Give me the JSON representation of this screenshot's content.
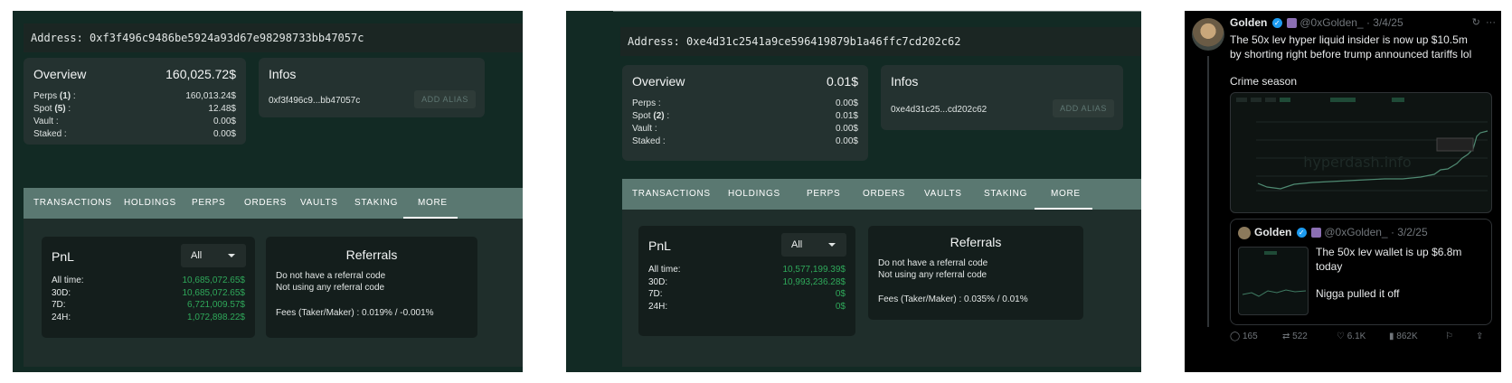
{
  "panel1": {
    "address": "Address: 0xf3f496c9486be5924a93d67e98298733bb47057c",
    "overview": {
      "title": "Overview",
      "total": "160,025.72$",
      "rows": [
        {
          "label": "Perps ",
          "count": "(1)",
          "suffix": " :",
          "value": "160,013.24$"
        },
        {
          "label": "Spot ",
          "count": "(5)",
          "suffix": " :",
          "value": "12.48$"
        },
        {
          "label": "Vault",
          "count": "",
          "suffix": " :",
          "value": "0.00$"
        },
        {
          "label": "Staked",
          "count": "",
          "suffix": " :",
          "value": "0.00$"
        }
      ]
    },
    "infos": {
      "title": "Infos",
      "address_short": "0xf3f496c9...bb47057c",
      "alias_button": "ADD ALIAS"
    },
    "tabs": [
      "TRANSACTIONS",
      "HOLDINGS",
      "PERPS",
      "ORDERS",
      "VAULTS",
      "STAKING",
      "MORE"
    ],
    "active_tab": "MORE",
    "pnl": {
      "title": "PnL",
      "select_value": "All",
      "rows": [
        {
          "label": "All time:",
          "value": "10,685,072.65$"
        },
        {
          "label": "30D:",
          "value": "10,685,072.65$"
        },
        {
          "label": "7D:",
          "value": "6,721,009.57$"
        },
        {
          "label": "24H:",
          "value": "1,072,898.22$"
        }
      ]
    },
    "referrals": {
      "title": "Referrals",
      "line1": "Do not have a referral code",
      "line2": "Not using any referral code",
      "fees": "Fees (Taker/Maker) : 0.019% / -0.001%"
    }
  },
  "panel2": {
    "address": "Address: 0xe4d31c2541a9ce596419879b1a46ffc7cd202c62",
    "overview": {
      "title": "Overview",
      "total": "0.01$",
      "rows": [
        {
          "label": "Perps",
          "count": "",
          "suffix": " :",
          "value": "0.00$"
        },
        {
          "label": "Spot ",
          "count": "(2)",
          "suffix": " :",
          "value": "0.01$"
        },
        {
          "label": "Vault",
          "count": "",
          "suffix": " :",
          "value": "0.00$"
        },
        {
          "label": "Staked",
          "count": "",
          "suffix": " :",
          "value": "0.00$"
        }
      ]
    },
    "infos": {
      "title": "Infos",
      "address_short": "0xe4d31c25...cd202c62",
      "alias_button": "ADD ALIAS"
    },
    "tabs": [
      "TRANSACTIONS",
      "HOLDINGS",
      "PERPS",
      "ORDERS",
      "VAULTS",
      "STAKING",
      "MORE"
    ],
    "active_tab": "MORE",
    "pnl": {
      "title": "PnL",
      "select_value": "All",
      "rows": [
        {
          "label": "All time:",
          "value": "10,577,199.39$"
        },
        {
          "label": "30D:",
          "value": "10,993,236.28$"
        },
        {
          "label": "7D:",
          "value": "0$"
        },
        {
          "label": "24H:",
          "value": "0$"
        }
      ]
    },
    "referrals": {
      "title": "Referrals",
      "line1": "Do not have a referral code",
      "line2": "Not using any referral code",
      "fees": "Fees (Taker/Maker) : 0.035% / 0.01%"
    }
  },
  "tweet": {
    "name": "Golden",
    "handle": "@0xGolden_",
    "date": "· 3/4/25",
    "text_line1": "The 50x lev hyper liquid insider is now up $10.5m",
    "text_line2": "by shorting right before trump announced tariffs lol",
    "text_line3": "Crime season",
    "chart_watermark": "hyperdash.info",
    "quote": {
      "name": "Golden",
      "handle": "@0xGolden_",
      "date": "· 3/2/25",
      "line1": "The 50x lev wallet is up $6.8m",
      "line2": "today",
      "line3": "Nigga pulled it off"
    },
    "stats": {
      "replies": "165",
      "reposts": "522",
      "likes": "6.1K",
      "views": "862K"
    }
  },
  "colors": {
    "hd_bg": "#122a24",
    "tab_bar": "#5a7871",
    "profit_green": "#2fa85a",
    "twitter_blue": "#1d9bf0"
  }
}
